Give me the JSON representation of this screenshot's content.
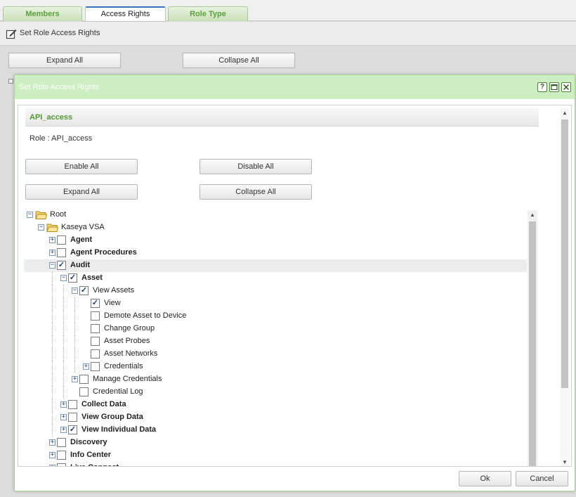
{
  "tabs": [
    {
      "label": "Members",
      "active": false
    },
    {
      "label": "Access Rights",
      "active": true
    },
    {
      "label": "Role Type",
      "active": false
    }
  ],
  "section": {
    "title": "Set Role Access Rights"
  },
  "background_buttons": {
    "expand": "Expand All",
    "collapse": "Collapse All"
  },
  "modal": {
    "title": "Set Role Access Rights",
    "help_icon": "help-icon",
    "maximize_icon": "maximize-icon",
    "close_icon": "close-icon",
    "role_header": "API_access",
    "role_label": "Role : API_access",
    "buttons": {
      "enable_all": "Enable All",
      "disable_all": "Disable All",
      "expand_all": "Expand All",
      "collapse_all": "Collapse All"
    },
    "tree": [
      {
        "label": "Root",
        "level": 0,
        "type": "folder",
        "expander": "minus"
      },
      {
        "label": "Kaseya VSA",
        "level": 1,
        "type": "folder",
        "expander": "minus"
      },
      {
        "label": "Agent",
        "level": 2,
        "bold": true,
        "checked": false,
        "expander": "plus"
      },
      {
        "label": "Agent Procedures",
        "level": 2,
        "bold": true,
        "checked": false,
        "expander": "plus"
      },
      {
        "label": "Audit",
        "level": 2,
        "bold": true,
        "checked": true,
        "expander": "minus",
        "selected": true
      },
      {
        "label": "Asset",
        "level": 3,
        "bold": true,
        "checked": true,
        "expander": "minus"
      },
      {
        "label": "View Assets",
        "level": 4,
        "bold": false,
        "checked": true,
        "expander": "minus"
      },
      {
        "label": "View",
        "level": 5,
        "bold": false,
        "checked": true,
        "expander": "none"
      },
      {
        "label": "Demote Asset to Device",
        "level": 5,
        "bold": false,
        "checked": false,
        "expander": "none"
      },
      {
        "label": "Change Group",
        "level": 5,
        "bold": false,
        "checked": false,
        "expander": "none"
      },
      {
        "label": "Asset Probes",
        "level": 5,
        "bold": false,
        "checked": false,
        "expander": "none"
      },
      {
        "label": "Asset Networks",
        "level": 5,
        "bold": false,
        "checked": false,
        "expander": "none"
      },
      {
        "label": "Credentials",
        "level": 5,
        "bold": false,
        "checked": false,
        "expander": "plus"
      },
      {
        "label": "Manage Credentials",
        "level": 4,
        "bold": false,
        "checked": false,
        "expander": "plus"
      },
      {
        "label": "Credential Log",
        "level": 4,
        "bold": false,
        "checked": false,
        "expander": "none"
      },
      {
        "label": "Collect Data",
        "level": 3,
        "bold": true,
        "checked": false,
        "expander": "plus"
      },
      {
        "label": "View Group Data",
        "level": 3,
        "bold": true,
        "checked": false,
        "expander": "plus"
      },
      {
        "label": "View Individual Data",
        "level": 3,
        "bold": true,
        "checked": true,
        "expander": "plus"
      },
      {
        "label": "Discovery",
        "level": 2,
        "bold": true,
        "checked": false,
        "expander": "plus"
      },
      {
        "label": "Info Center",
        "level": 2,
        "bold": true,
        "checked": false,
        "expander": "plus"
      },
      {
        "label": "Live Connect",
        "level": 2,
        "bold": true,
        "checked": false,
        "expander": "plus"
      }
    ],
    "footer": {
      "ok": "Ok",
      "cancel": "Cancel"
    }
  }
}
